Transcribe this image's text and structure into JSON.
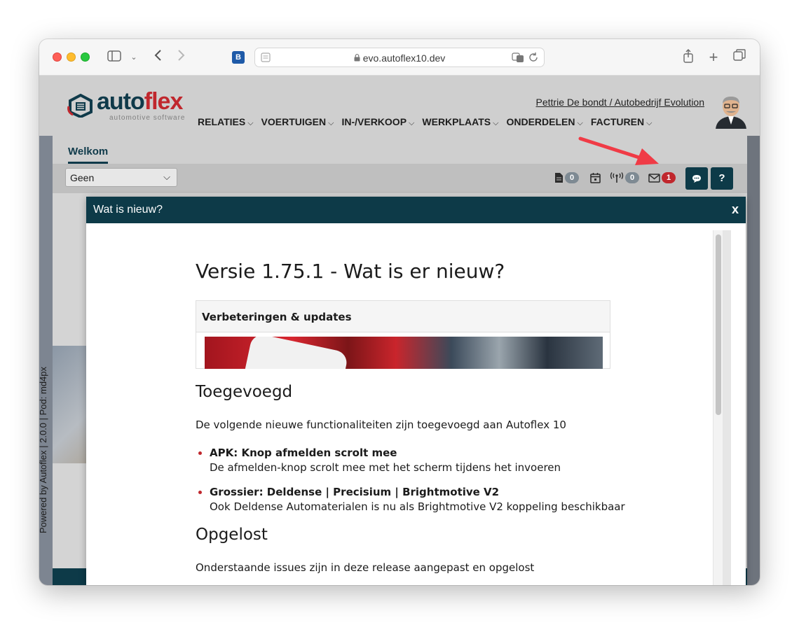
{
  "browser": {
    "url": "evo.autoflex10.dev"
  },
  "header": {
    "logo_main": "auto",
    "logo_accent": "flex",
    "logo_sub": "automotive software",
    "user_link": "Pettrie De bondt / Autobedrijf Evolution",
    "nav": [
      {
        "label": "RELATIES"
      },
      {
        "label": "VOERTUIGEN"
      },
      {
        "label": "IN-/VERKOOP"
      },
      {
        "label": "WERKPLAATS"
      },
      {
        "label": "ONDERDELEN"
      },
      {
        "label": "FACTUREN"
      }
    ]
  },
  "sidebar": {
    "text": "Powered by Autoflex | 2.0.0 | Pod: md4px"
  },
  "tabs": [
    {
      "label": "Welkom"
    }
  ],
  "filter": {
    "selected": "Geen",
    "documents_count": "0",
    "signal_count": "0",
    "mail_count": "1",
    "help_label": "?"
  },
  "colors": {
    "brand_dark": "#0d3a48",
    "brand_red": "#c0272d",
    "arrow": "#f03b46"
  },
  "modal": {
    "title": "Wat is nieuw?",
    "close_label": "x",
    "heading": "Versie 1.75.1 - Wat is er nieuw?",
    "card_title": "Verbeteringen & updates",
    "added_title": "Toegevoegd",
    "added_intro": "De volgende nieuwe functionaliteiten zijn toegevoegd aan Autoflex 10",
    "items": [
      {
        "title": "APK: Knop afmelden scrolt mee",
        "desc": "De afmelden-knop scrolt mee met het scherm tijdens het invoeren"
      },
      {
        "title": "Grossier: Deldense | Precisium | Brightmotive V2",
        "desc": "Ook Deldense Automaterialen is nu als Brightmotive V2 koppeling beschikbaar"
      }
    ],
    "fixed_title": "Opgelost",
    "fixed_intro": "Onderstaande issues zijn in deze release aangepast en opgelost"
  }
}
